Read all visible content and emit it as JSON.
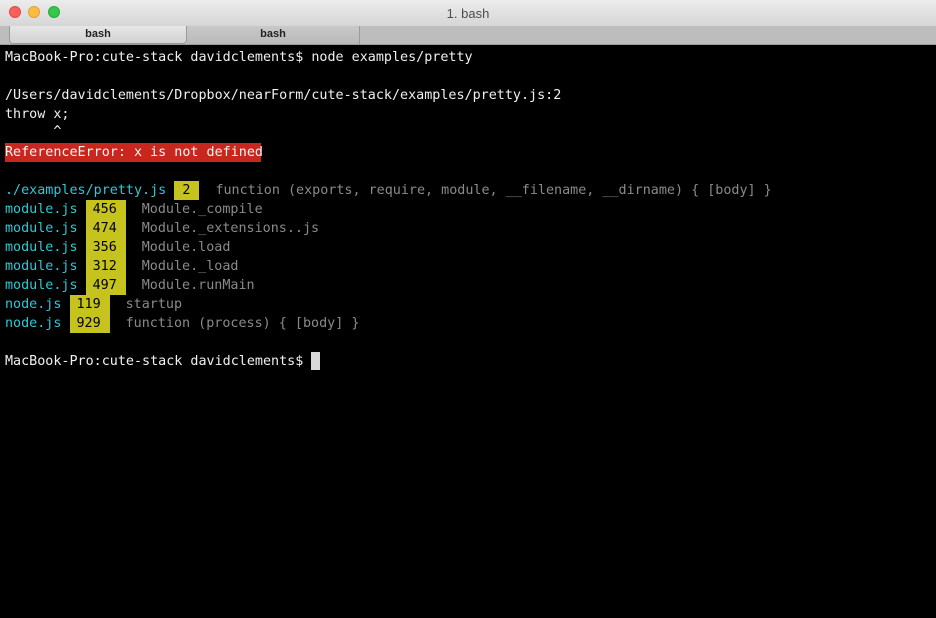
{
  "window": {
    "title": "1. bash",
    "tabs": [
      {
        "label": "bash",
        "active": true
      },
      {
        "label": "bash",
        "active": false
      }
    ]
  },
  "terminal": {
    "prompt_line": "MacBook-Pro:cute-stack davidclements$ node examples/pretty",
    "file_location": "/Users/davidclements/Dropbox/nearForm/cute-stack/examples/pretty.js:2",
    "code_line": "throw x;",
    "caret_line": "      ^",
    "error": "ReferenceError: x is not defined",
    "frames": [
      {
        "file": "./examples/pretty.js",
        "line": "2",
        "fn": "function (exports, require, module, __filename, __dirname) { [body] }"
      },
      {
        "file": "module.js",
        "line": "456",
        "fn": "Module._compile"
      },
      {
        "file": "module.js",
        "line": "474",
        "fn": "Module._extensions..js"
      },
      {
        "file": "module.js",
        "line": "356",
        "fn": "Module.load"
      },
      {
        "file": "module.js",
        "line": "312",
        "fn": "Module._load"
      },
      {
        "file": "module.js",
        "line": "497",
        "fn": "Module.runMain"
      },
      {
        "file": "node.js",
        "line": "119",
        "fn": "startup"
      },
      {
        "file": "node.js",
        "line": "929",
        "fn": "function (process) { [body] }"
      }
    ],
    "final_prompt": "MacBook-Pro:cute-stack davidclements$ "
  },
  "colors": {
    "file": "#2ec9d3",
    "line_highlight": "#c6c21e",
    "error_bg": "#c8271e",
    "function_text": "#8a8a8a"
  }
}
